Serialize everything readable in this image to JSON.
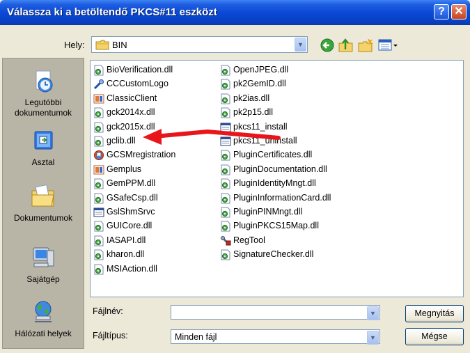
{
  "window": {
    "title": "Válassza ki a betöltendő PKCS#11 eszközt",
    "help_glyph": "?",
    "close_glyph": "✕"
  },
  "location": {
    "label": "Hely:",
    "value": "BIN"
  },
  "places": [
    {
      "label": "Legutóbbi dokumentumok",
      "icon": "recent-documents-icon"
    },
    {
      "label": "Asztal",
      "icon": "desktop-icon"
    },
    {
      "label": "Dokumentumok",
      "icon": "my-documents-icon"
    },
    {
      "label": "Sajátgép",
      "icon": "my-computer-icon"
    },
    {
      "label": "Hálózati helyek",
      "icon": "network-places-icon"
    }
  ],
  "files_col1": [
    {
      "name": "BioVerification.dll",
      "icon": "dll"
    },
    {
      "name": "CCCustomLogo",
      "icon": "tool"
    },
    {
      "name": "ClassicClient",
      "icon": "app"
    },
    {
      "name": "gck2014x.dll",
      "icon": "dll"
    },
    {
      "name": "gck2015x.dll",
      "icon": "dll"
    },
    {
      "name": "gclib.dll",
      "icon": "dll"
    },
    {
      "name": "GCSMregistration",
      "icon": "setup"
    },
    {
      "name": "Gemplus",
      "icon": "app"
    },
    {
      "name": "GemPPM.dll",
      "icon": "dll"
    },
    {
      "name": "GSafeCsp.dll",
      "icon": "dll"
    },
    {
      "name": "GslShmSrvc",
      "icon": "window"
    },
    {
      "name": "GUICore.dll",
      "icon": "dll"
    },
    {
      "name": "IASAPI.dll",
      "icon": "dll"
    },
    {
      "name": "kharon.dll",
      "icon": "dll"
    },
    {
      "name": "MSIAction.dll",
      "icon": "dll"
    }
  ],
  "files_col2": [
    {
      "name": "OpenJPEG.dll",
      "icon": "dll"
    },
    {
      "name": "pk2GemID.dll",
      "icon": "dll"
    },
    {
      "name": "pk2ias.dll",
      "icon": "dll"
    },
    {
      "name": "pk2p15.dll",
      "icon": "dll"
    },
    {
      "name": "pkcs11_install",
      "icon": "window"
    },
    {
      "name": "pkcs11_uninstall",
      "icon": "window"
    },
    {
      "name": "PluginCertificates.dll",
      "icon": "dll"
    },
    {
      "name": "PluginDocumentation.dll",
      "icon": "dll"
    },
    {
      "name": "PluginIdentityMngt.dll",
      "icon": "dll"
    },
    {
      "name": "PluginInformationCard.dll",
      "icon": "dll"
    },
    {
      "name": "PluginPINMngt.dll",
      "icon": "dll"
    },
    {
      "name": "PluginPKCS15Map.dll",
      "icon": "dll"
    },
    {
      "name": "RegTool",
      "icon": "regtool"
    },
    {
      "name": "SignatureChecker.dll",
      "icon": "dll"
    }
  ],
  "filename": {
    "label": "Fájlnév:",
    "value": ""
  },
  "filetype": {
    "label": "Fájltípus:",
    "value": "Minden fájl"
  },
  "buttons": {
    "open": "Megnyitás",
    "cancel": "Mégse"
  },
  "colors": {
    "titlebar": "#0a49d6",
    "annotation_arrow": "#e8161b"
  }
}
